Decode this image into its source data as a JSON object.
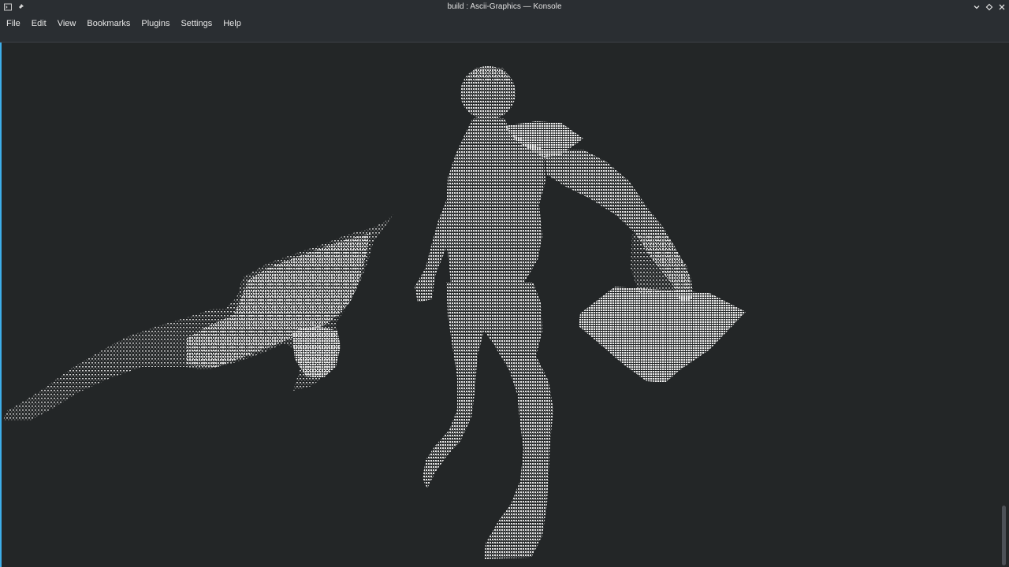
{
  "window": {
    "title": "build : Ascii-Graphics — Konsole",
    "icons": {
      "app": "terminal-icon",
      "pin": "pin-icon",
      "minimize": "chevron-down-icon",
      "maximize": "diamond-icon",
      "close": "close-icon"
    }
  },
  "menu": {
    "items": [
      "File",
      "Edit",
      "View",
      "Bookmarks",
      "Plugins",
      "Settings",
      "Help"
    ]
  },
  "terminal": {
    "content": "ascii-render",
    "fg_color": "#d8d8d8",
    "bg_color": "#232627",
    "accent": "#3daee9"
  }
}
